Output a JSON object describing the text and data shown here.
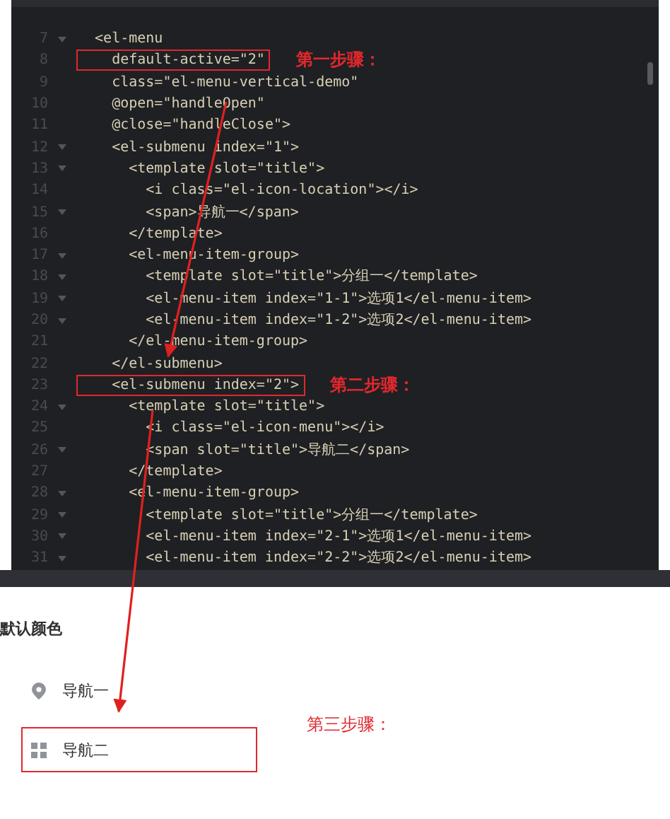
{
  "editor": {
    "lines": [
      {
        "number": "7",
        "fold": true,
        "text": "  <el-menu"
      },
      {
        "number": "8",
        "fold": false,
        "text": "    default-active=\"2\"",
        "boxed": true,
        "note": "第一步骤："
      },
      {
        "number": "9",
        "fold": false,
        "text": "    class=\"el-menu-vertical-demo\""
      },
      {
        "number": "10",
        "fold": false,
        "text": "    @open=\"handleOpen\""
      },
      {
        "number": "11",
        "fold": false,
        "text": "    @close=\"handleClose\">"
      },
      {
        "number": "12",
        "fold": true,
        "text": "    <el-submenu index=\"1\">"
      },
      {
        "number": "13",
        "fold": true,
        "text": "      <template slot=\"title\">"
      },
      {
        "number": "14",
        "fold": false,
        "text": "        <i class=\"el-icon-location\"></i>"
      },
      {
        "number": "15",
        "fold": true,
        "text": "        <span>导航一</span>"
      },
      {
        "number": "16",
        "fold": false,
        "text": "      </template>"
      },
      {
        "number": "17",
        "fold": true,
        "text": "      <el-menu-item-group>"
      },
      {
        "number": "18",
        "fold": true,
        "text": "        <template slot=\"title\">分组一</template>"
      },
      {
        "number": "19",
        "fold": true,
        "text": "        <el-menu-item index=\"1-1\">选项1</el-menu-item>"
      },
      {
        "number": "20",
        "fold": true,
        "text": "        <el-menu-item index=\"1-2\">选项2</el-menu-item>"
      },
      {
        "number": "21",
        "fold": false,
        "text": "      </el-menu-item-group>"
      },
      {
        "number": "22",
        "fold": false,
        "text": "    </el-submenu>"
      },
      {
        "number": "23",
        "fold": false,
        "text": "    <el-submenu index=\"2\">",
        "boxed": true,
        "note": "第二步骤："
      },
      {
        "number": "24",
        "fold": true,
        "text": "      <template slot=\"title\">"
      },
      {
        "number": "25",
        "fold": false,
        "text": "        <i class=\"el-icon-menu\"></i>"
      },
      {
        "number": "26",
        "fold": true,
        "text": "        <span slot=\"title\">导航二</span>"
      },
      {
        "number": "27",
        "fold": false,
        "text": "      </template>"
      },
      {
        "number": "28",
        "fold": true,
        "text": "      <el-menu-item-group>"
      },
      {
        "number": "29",
        "fold": true,
        "text": "        <template slot=\"title\">分组一</template>"
      },
      {
        "number": "30",
        "fold": true,
        "text": "        <el-menu-item index=\"2-1\">选项1</el-menu-item>"
      },
      {
        "number": "31",
        "fold": true,
        "text": "        <el-menu-item index=\"2-2\">选项2</el-menu-item>"
      }
    ]
  },
  "preview": {
    "heading": "默认颜色",
    "items": [
      {
        "label": "导航一",
        "kind": "location",
        "highlighted": false
      },
      {
        "label": "导航二",
        "kind": "grid",
        "highlighted": true,
        "note": "第三步骤："
      }
    ]
  }
}
